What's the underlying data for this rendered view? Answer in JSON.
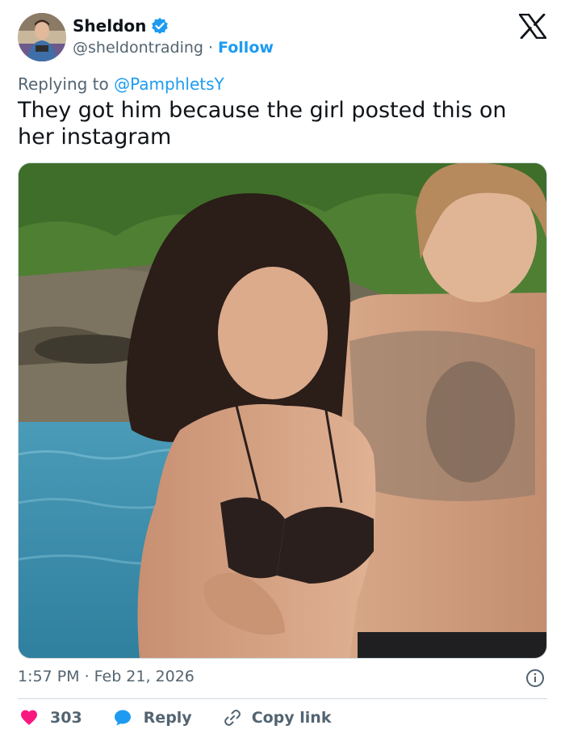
{
  "author": {
    "name": "Sheldon",
    "handle": "@sheldontrading",
    "separator": "·",
    "follow_label": "Follow",
    "verified": true
  },
  "replying": {
    "prefix": "Replying to",
    "mention": "@PamphletsY"
  },
  "tweet": {
    "text": "They got him because the girl posted this on her instagram"
  },
  "meta": {
    "time": "1:57 PM",
    "separator": "·",
    "date": "Feb 21, 2026"
  },
  "actions": {
    "like_count": "303",
    "reply_label": "Reply",
    "copy_label": "Copy link"
  },
  "colors": {
    "accent": "#1d9bf0",
    "like": "#f91880",
    "muted": "#536471",
    "text": "#0f1419"
  },
  "icons": {
    "verified": "verified-badge-icon",
    "logo": "x-logo-icon",
    "info": "info-icon",
    "like": "heart-icon",
    "reply": "speech-bubble-icon",
    "copy": "link-icon"
  }
}
